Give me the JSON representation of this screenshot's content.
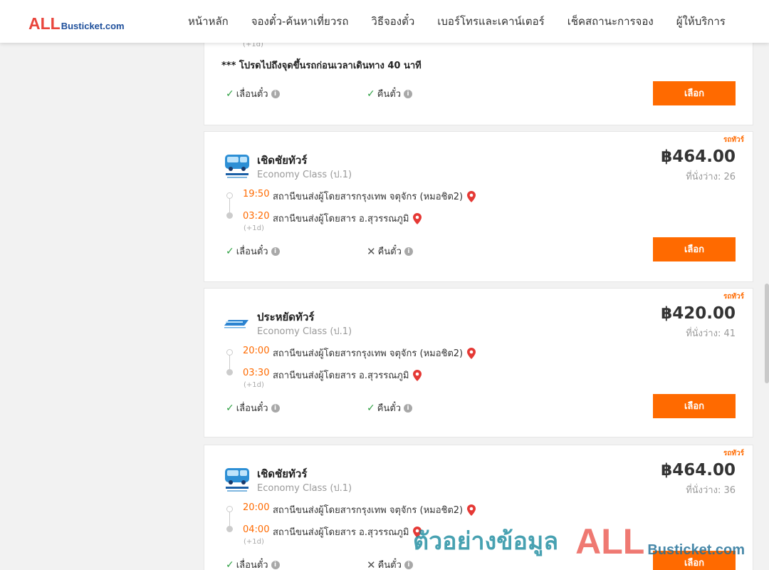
{
  "header": {
    "logo_all": "ALL",
    "logo_rest": "Busticket.com",
    "nav": [
      "หน้าหลัก",
      "จองตั๋ว-ค้นหาเที่ยวรถ",
      "วิธีจองตั๋ว",
      "เบอร์โทรและเคาน์เตอร์",
      "เช็คสถานะการจอง",
      "ผู้ให้บริการ"
    ]
  },
  "partial_card": {
    "next_day": "(+1d)",
    "notice": "*** โปรดไปถึงจุดขึ้นรถก่อนเวลาเดินทาง 40 นาที",
    "opt_change": "เลื่อนตั๋ว",
    "opt_refund": "คืนตั๋ว",
    "select_label": "เลือก"
  },
  "trips": [
    {
      "tag": "รถทัวร์",
      "operator": "เชิดชัยทัวร์",
      "class": "Economy Class (ป.1)",
      "price": "฿464.00",
      "seats": "ที่นั่งว่าง: 26",
      "dep_time": "19:50",
      "dep_station": "สถานีขนส่งผู้โดยสารกรุงเทพ จตุจักร (หมอชิต2)",
      "arr_time": "03:20",
      "arr_station": "สถานีขนส่งผู้โดยสาร อ.สุวรรณภูมิ",
      "next_day": "(+1d)",
      "opt_change": "เลื่อนตั๋ว",
      "opt_refund": "คืนตั๋ว",
      "refund_allowed": false,
      "select_label": "เลือก"
    },
    {
      "tag": "รถทัวร์",
      "operator": "ประหยัดทัวร์",
      "class": "Economy Class (ป.1)",
      "price": "฿420.00",
      "seats": "ที่นั่งว่าง: 41",
      "dep_time": "20:00",
      "dep_station": "สถานีขนส่งผู้โดยสารกรุงเทพ จตุจักร (หมอชิต2)",
      "arr_time": "03:30",
      "arr_station": "สถานีขนส่งผู้โดยสาร อ.สุวรรณภูมิ",
      "next_day": "(+1d)",
      "opt_change": "เลื่อนตั๋ว",
      "opt_refund": "คืนตั๋ว",
      "refund_allowed": true,
      "select_label": "เลือก"
    },
    {
      "tag": "รถทัวร์",
      "operator": "เชิดชัยทัวร์",
      "class": "Economy Class (ป.1)",
      "price": "฿464.00",
      "seats": "ที่นั่งว่าง: 36",
      "dep_time": "20:00",
      "dep_station": "สถานีขนส่งผู้โดยสารกรุงเทพ จตุจักร (หมอชิต2)",
      "arr_time": "04:00",
      "arr_station": "สถานีขนส่งผู้โดยสาร อ.สุวรรณภูมิ",
      "next_day": "(+1d)",
      "opt_change": "เลื่อนตั๋ว",
      "opt_refund": "คืนตั๋ว",
      "refund_allowed": false,
      "select_label": "เลือก"
    }
  ],
  "watermark": {
    "thai": "ตัวอย่างข้อมูล",
    "all": "ALL",
    "rest": "Busticket.com"
  },
  "colors": {
    "accent": "#ff6a00",
    "check": "#2ea043",
    "pin": "#e53935",
    "logo_red": "#e9453c",
    "logo_blue": "#1e4f9b"
  },
  "icons": {
    "check": "check-icon",
    "cross": "x-icon",
    "info": "info-icon",
    "pin": "map-pin-icon"
  }
}
